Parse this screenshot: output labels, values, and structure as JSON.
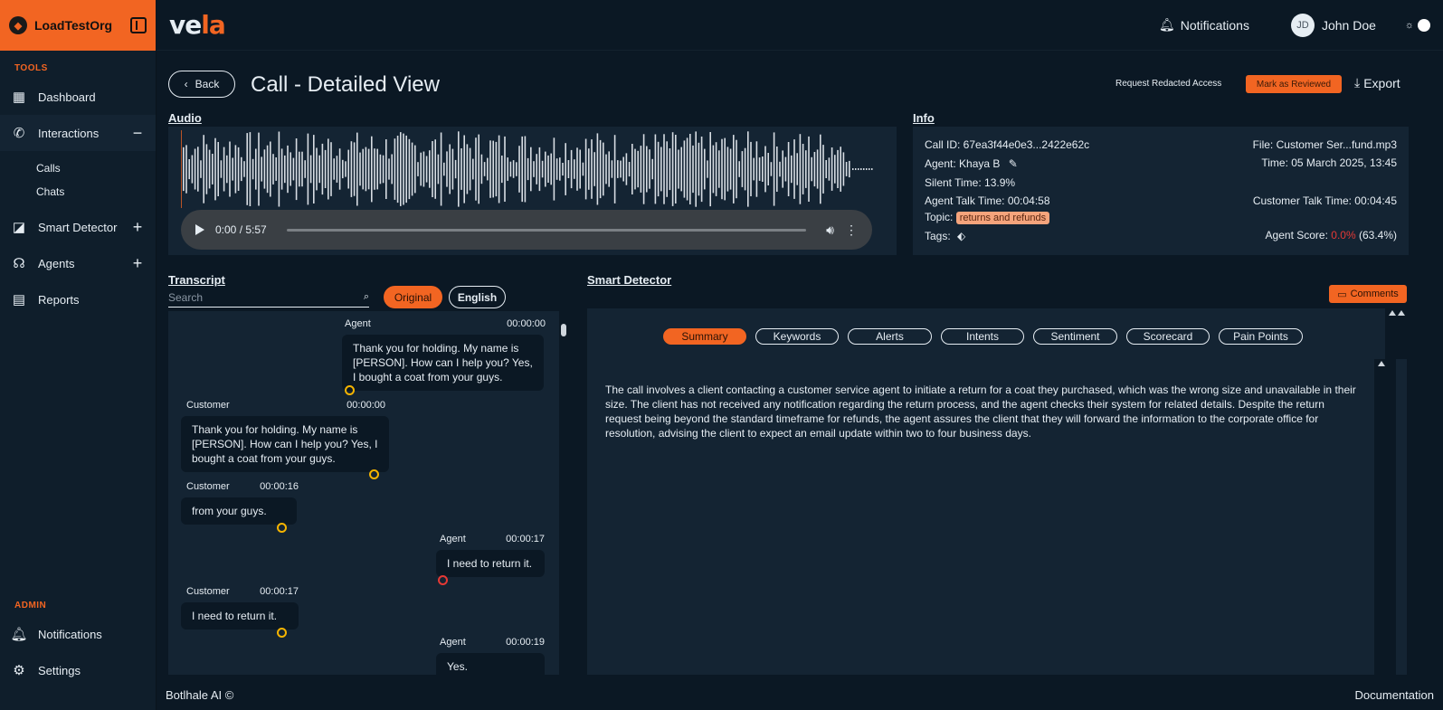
{
  "org": {
    "name": "LoadTestOrg",
    "logo_initial": "◆"
  },
  "sidebar": {
    "tools_title": "TOOLS",
    "items": [
      {
        "label": "Dashboard",
        "icon": "dashboard-icon"
      },
      {
        "label": "Interactions",
        "icon": "phone-icon",
        "toggle": "−"
      },
      {
        "label": "Smart Detector",
        "icon": "chart-icon",
        "toggle": "+"
      },
      {
        "label": "Agents",
        "icon": "headset-icon",
        "toggle": "+"
      },
      {
        "label": "Reports",
        "icon": "report-icon"
      }
    ],
    "sub_items": [
      "Calls",
      "Chats"
    ],
    "admin_title": "ADMIN",
    "admin_items": [
      {
        "label": "Notifications",
        "icon": "bell-icon"
      },
      {
        "label": "Settings",
        "icon": "gear-icon"
      }
    ]
  },
  "topbar": {
    "brand_left": "ve",
    "brand_right": "la",
    "notifications": "Notifications",
    "avatar_initials": "JD",
    "user_name": "John Doe"
  },
  "header": {
    "back_label": "Back",
    "title": "Call - Detailed View",
    "request_access": "Request Redacted Access",
    "mark_reviewed": "Mark as Reviewed",
    "export": "Export"
  },
  "audio": {
    "section_title": "Audio",
    "time": "0:00 / 5:57"
  },
  "info": {
    "section_title": "Info",
    "call_id": "Call ID: 67ea3f44e0e3...2422e62c",
    "file": "File: Customer Ser...fund.mp3",
    "agent": "Agent: Khaya B",
    "time": "Time: 05 March 2025, 13:45",
    "silent_time": "Silent Time: 13.9%",
    "agent_talk": "Agent Talk Time: 00:04:58",
    "customer_talk": "Customer Talk Time: 00:04:45",
    "topic_label": "Topic:",
    "topic_value": "returns and refunds",
    "tags_label": "Tags:",
    "score_label": "Agent Score:",
    "score_value": "0.0%",
    "score_pct": "(63.4%)"
  },
  "transcript": {
    "section_title": "Transcript",
    "search_placeholder": "Search",
    "lang_original": "Original",
    "lang_english": "English",
    "messages": [
      {
        "speaker": "Agent",
        "time": "00:00:00",
        "text": "Thank you for holding. My name is [PERSON]. How can I help you? Yes, I bought a coat from your guys."
      },
      {
        "speaker": "Customer",
        "time": "00:00:00",
        "text": "Thank you for holding. My name is [PERSON]. How can I help you? Yes, I bought a coat from your guys."
      },
      {
        "speaker": "Customer",
        "time": "00:00:16",
        "text": "from your guys."
      },
      {
        "speaker": "Agent",
        "time": "00:00:17",
        "text": "I need to return it."
      },
      {
        "speaker": "Customer",
        "time": "00:00:17",
        "text": "I need to return it."
      },
      {
        "speaker": "Agent",
        "time": "00:00:19",
        "text": "Yes."
      }
    ]
  },
  "detector": {
    "section_title": "Smart Detector",
    "comments": "Comments",
    "tabs": [
      "Summary",
      "Keywords",
      "Alerts",
      "Intents",
      "Sentiment",
      "Scorecard",
      "Pain Points"
    ],
    "summary": "The call involves a client contacting a customer service agent to initiate a return for a coat they purchased, which was the wrong size and unavailable in their size. The client has not received any notification regarding the return process, and the agent checks their system for related details. Despite the return request being beyond the standard timeframe for refunds, the agent assures the client that they will forward the information to the corporate office for resolution, advising the client to expect an email update within two to four business days."
  },
  "footer": {
    "left": "Botlhale AI ©",
    "right": "Documentation"
  },
  "colors": {
    "accent": "#f26522",
    "panel": "#142433",
    "bg": "#0b1824"
  }
}
